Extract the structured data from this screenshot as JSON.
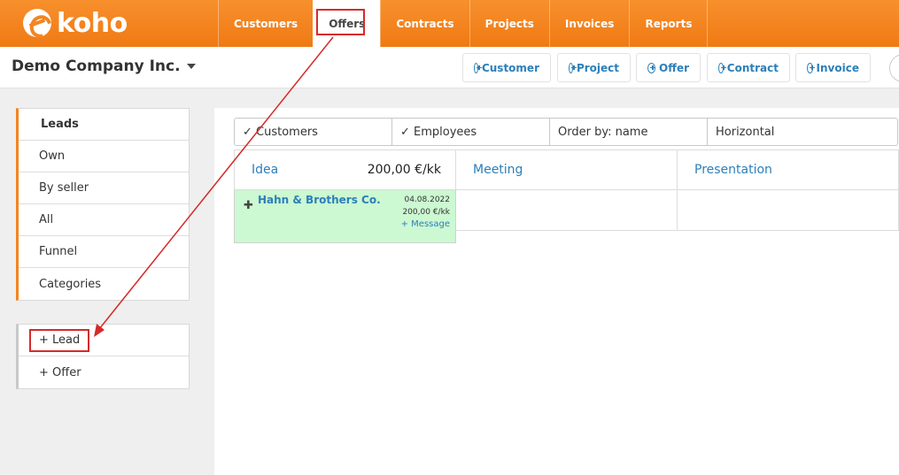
{
  "logo": {
    "text": "koho"
  },
  "nav": {
    "items": [
      {
        "label": "Customers"
      },
      {
        "label": "Offers",
        "active": true
      },
      {
        "label": "Contracts"
      },
      {
        "label": "Projects"
      },
      {
        "label": "Invoices"
      },
      {
        "label": "Reports"
      }
    ]
  },
  "company": {
    "name": "Demo Company Inc."
  },
  "quick_actions": [
    {
      "label": "Customer"
    },
    {
      "label": "Project"
    },
    {
      "label": "Offer"
    },
    {
      "label": "Contract"
    },
    {
      "label": "Invoice"
    }
  ],
  "sidebar": {
    "group1": [
      "Leads",
      "Own",
      "By seller",
      "All",
      "Funnel",
      "Categories"
    ],
    "group2": [
      "+ Lead",
      "+ Offer"
    ]
  },
  "filters": [
    "✓ Customers",
    "✓ Employees",
    "Order by: name",
    "Horizontal"
  ],
  "columns": [
    {
      "title": "Idea",
      "sum": "200,00 €/kk"
    },
    {
      "title": "Meeting",
      "sum": ""
    },
    {
      "title": "Presentation",
      "sum": ""
    }
  ],
  "card": {
    "icon": "plus-icon",
    "name": "Hahn & Brothers Co.",
    "date": "04.08.2022",
    "amount": "200,00 €/kk",
    "message_link": "+ Message"
  },
  "colors": {
    "brand": "#f38520",
    "link": "#2c7fb8",
    "card_bg": "#ccf8d2",
    "annotation": "#d62a2a"
  }
}
